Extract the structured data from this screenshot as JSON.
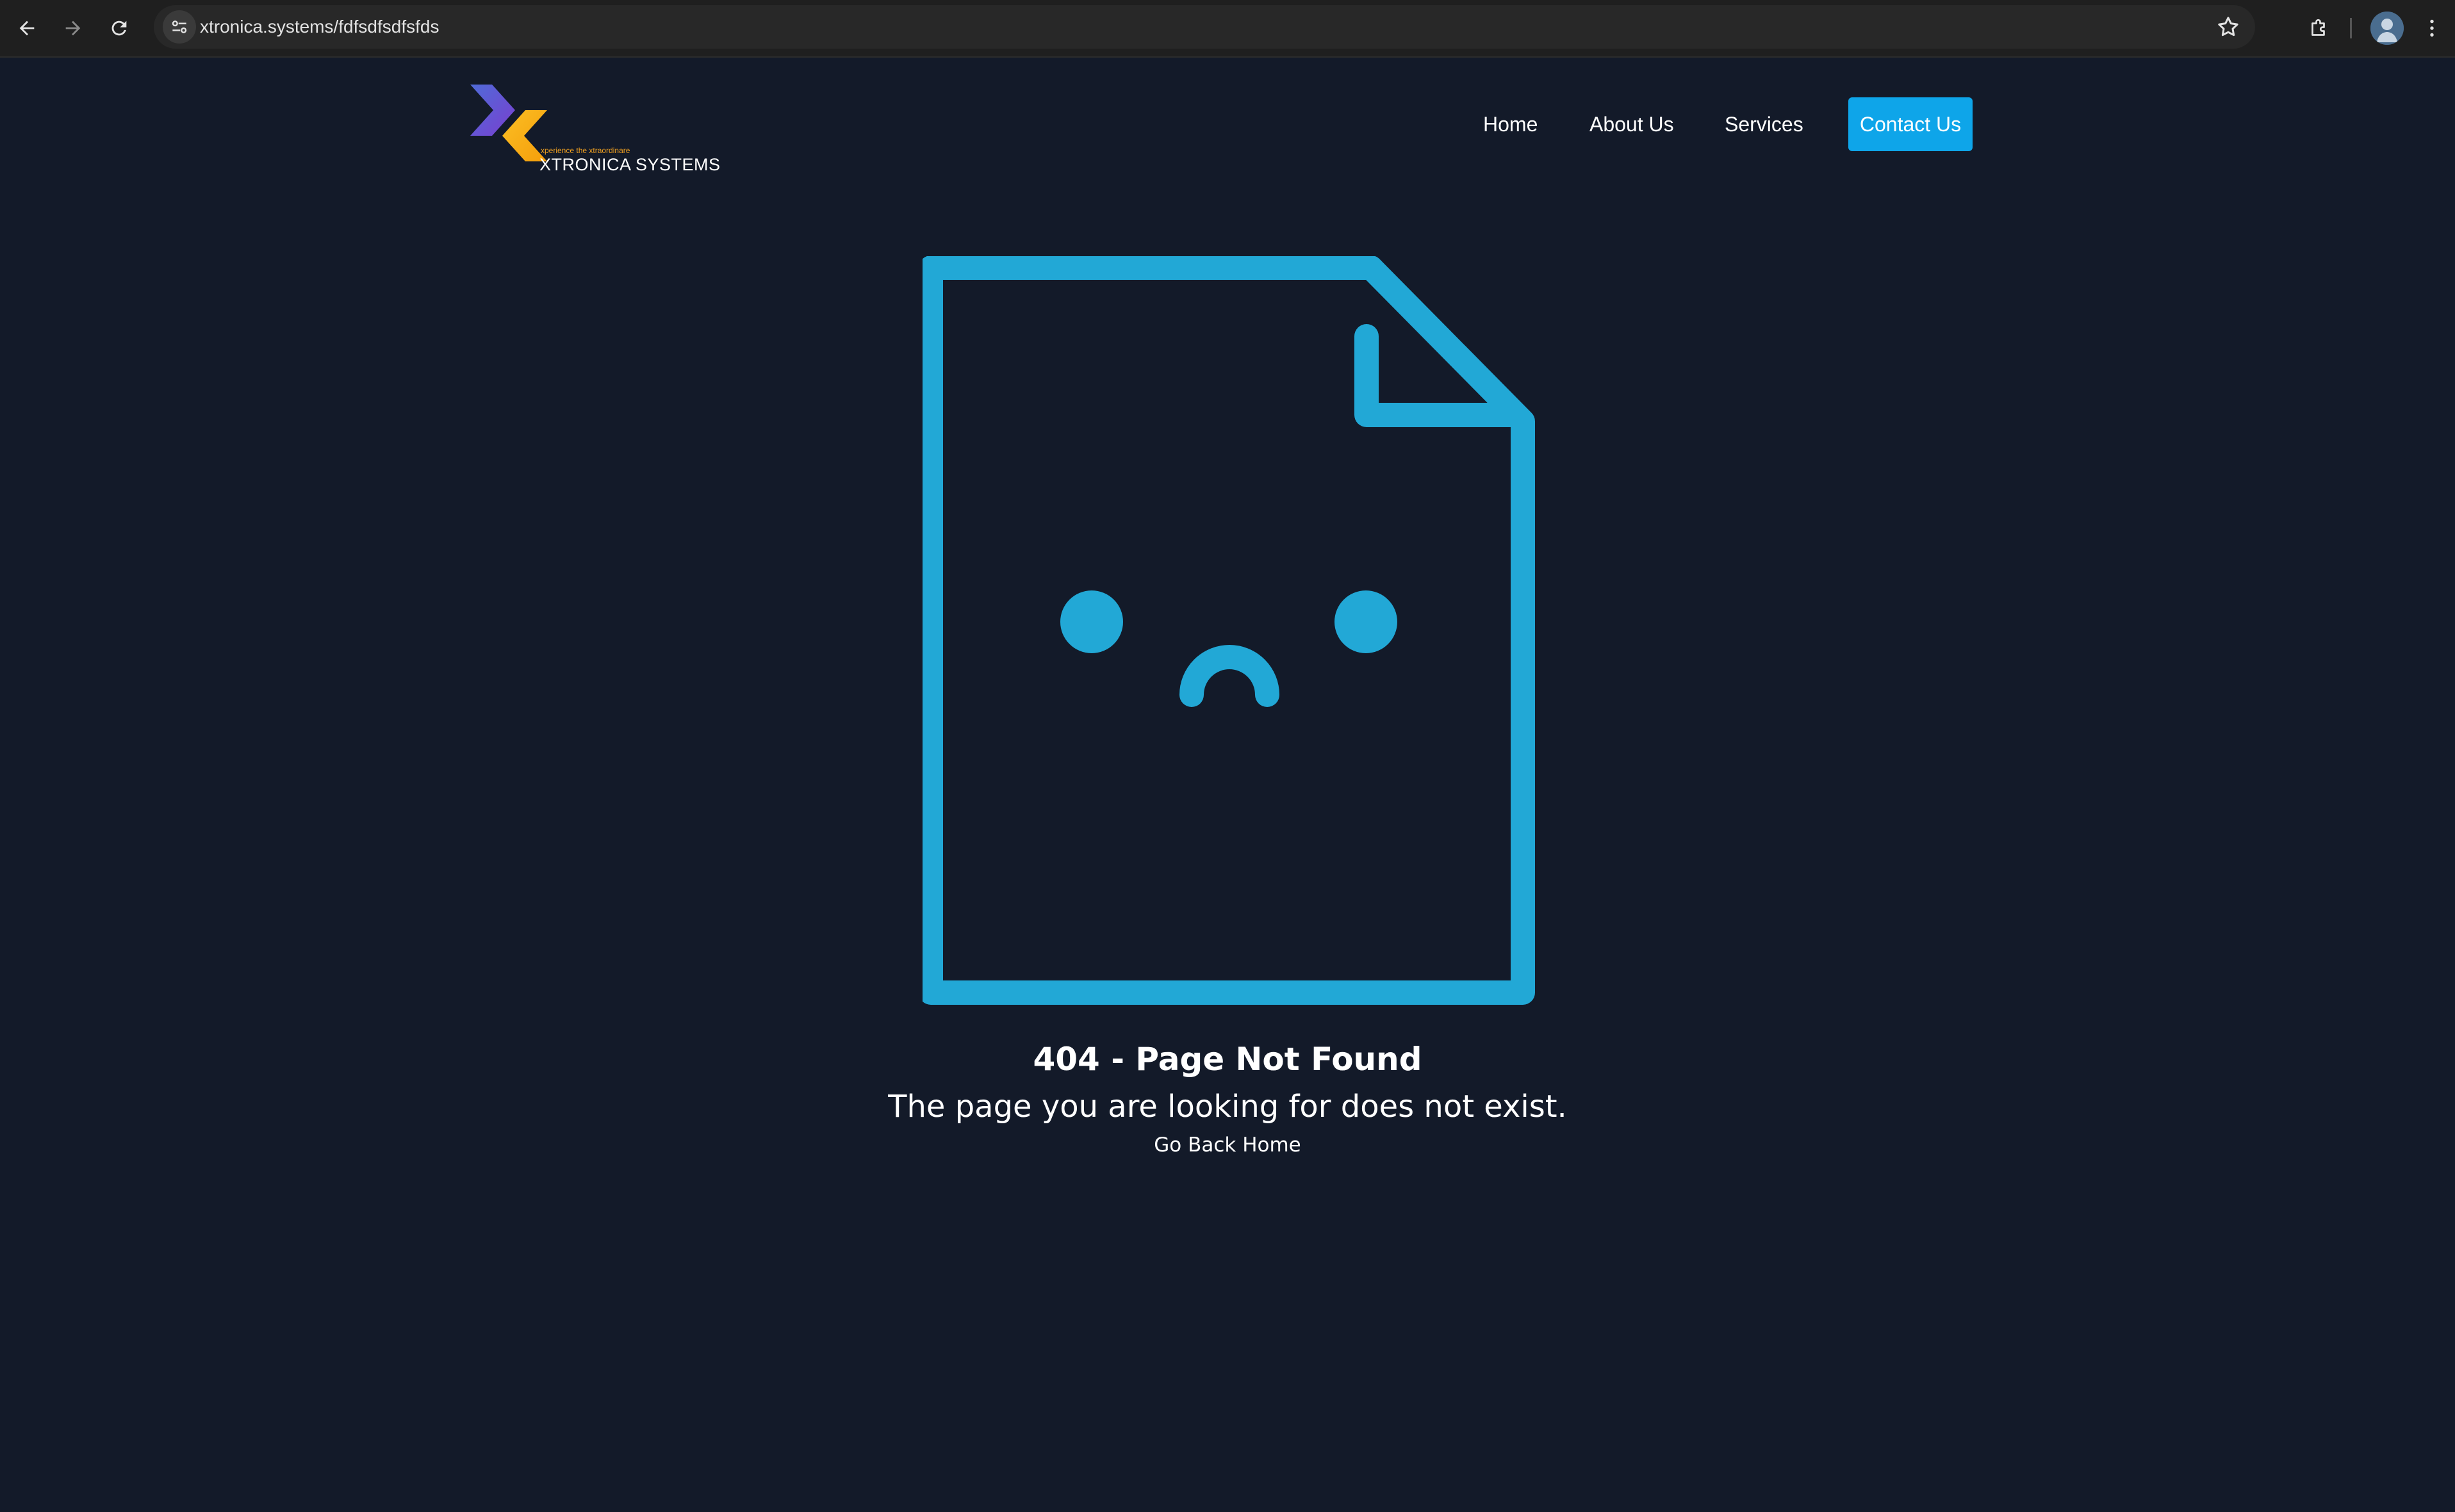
{
  "browser": {
    "url": "xtronica.systems/fdfsdfsdfsfds",
    "icons": [
      "back-arrow-icon",
      "forward-arrow-icon",
      "reload-icon",
      "site-info-icon",
      "bookmark-star-icon",
      "extensions-icon",
      "profile-avatar",
      "more-menu-icon"
    ]
  },
  "header": {
    "logo_tagline": "xperience the xtraordinare",
    "logo_name": "XTRONICA SYSTEMS",
    "nav": {
      "home": "Home",
      "about": "About Us",
      "services": "Services",
      "contact": "Contact Us"
    }
  },
  "main": {
    "title": "404 - Page Not Found",
    "message": "The page you are looking for does not exist.",
    "home_link": "Go Back Home"
  },
  "colors": {
    "background": "#131a29",
    "accent": "#0ea5e9",
    "illustration": "#22a8d6",
    "logo_blue": "#4f6bd8",
    "logo_purple": "#7a3fd0",
    "logo_yellow": "#fbbf24",
    "logo_orange": "#f59e0b"
  }
}
